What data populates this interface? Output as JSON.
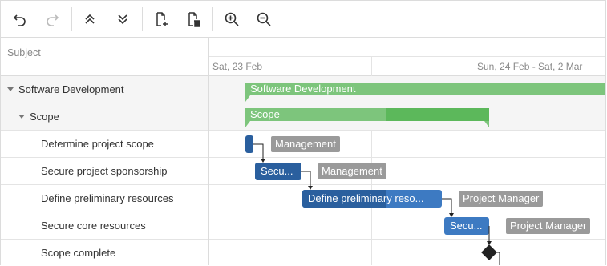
{
  "toolbar": {
    "buttons": [
      {
        "name": "undo-button",
        "icon": "undo-icon",
        "enabled": true
      },
      {
        "name": "redo-button",
        "icon": "redo-icon",
        "enabled": false
      },
      {
        "name": "move-up-button",
        "icon": "double-chevron-up-icon",
        "enabled": true
      },
      {
        "name": "move-down-button",
        "icon": "double-chevron-down-icon",
        "enabled": true
      },
      {
        "name": "add-task-button",
        "icon": "add-document-icon",
        "enabled": true
      },
      {
        "name": "delete-task-button",
        "icon": "delete-document-icon",
        "enabled": true
      },
      {
        "name": "zoom-in-button",
        "icon": "zoom-in-icon",
        "enabled": true
      },
      {
        "name": "zoom-out-button",
        "icon": "zoom-out-icon",
        "enabled": true
      }
    ]
  },
  "tree": {
    "header": "Subject",
    "rows": [
      {
        "label": "Software Development",
        "level": 0,
        "expanded": true,
        "group": true
      },
      {
        "label": "Scope",
        "level": 1,
        "expanded": true,
        "group": true
      },
      {
        "label": "Determine project scope",
        "level": 2
      },
      {
        "label": "Secure project sponsorship",
        "level": 2
      },
      {
        "label": "Define preliminary resources",
        "level": 2
      },
      {
        "label": "Secure core resources",
        "level": 2
      },
      {
        "label": "Scope complete",
        "level": 2
      }
    ]
  },
  "timescale": {
    "labels": [
      "Sat, 23 Feb",
      "Sun, 24 Feb - Sat, 2 Mar"
    ]
  },
  "chart": {
    "summaries": [
      {
        "title": "Software Development"
      },
      {
        "title": "Scope"
      }
    ],
    "tasks": [
      {
        "title": "",
        "resource": "Management"
      },
      {
        "title": "Secu...",
        "resource": "Management"
      },
      {
        "title": "Define preliminary reso...",
        "resource": "Project Manager"
      },
      {
        "title": "Secu...",
        "resource": "Project Manager"
      }
    ]
  },
  "colors": {
    "summary": "#7dc57c",
    "summary_progress": "#5cb85b",
    "task": "#3d7ac2",
    "task_progress": "#2a5f9e",
    "resource": "#9a9a9a"
  }
}
